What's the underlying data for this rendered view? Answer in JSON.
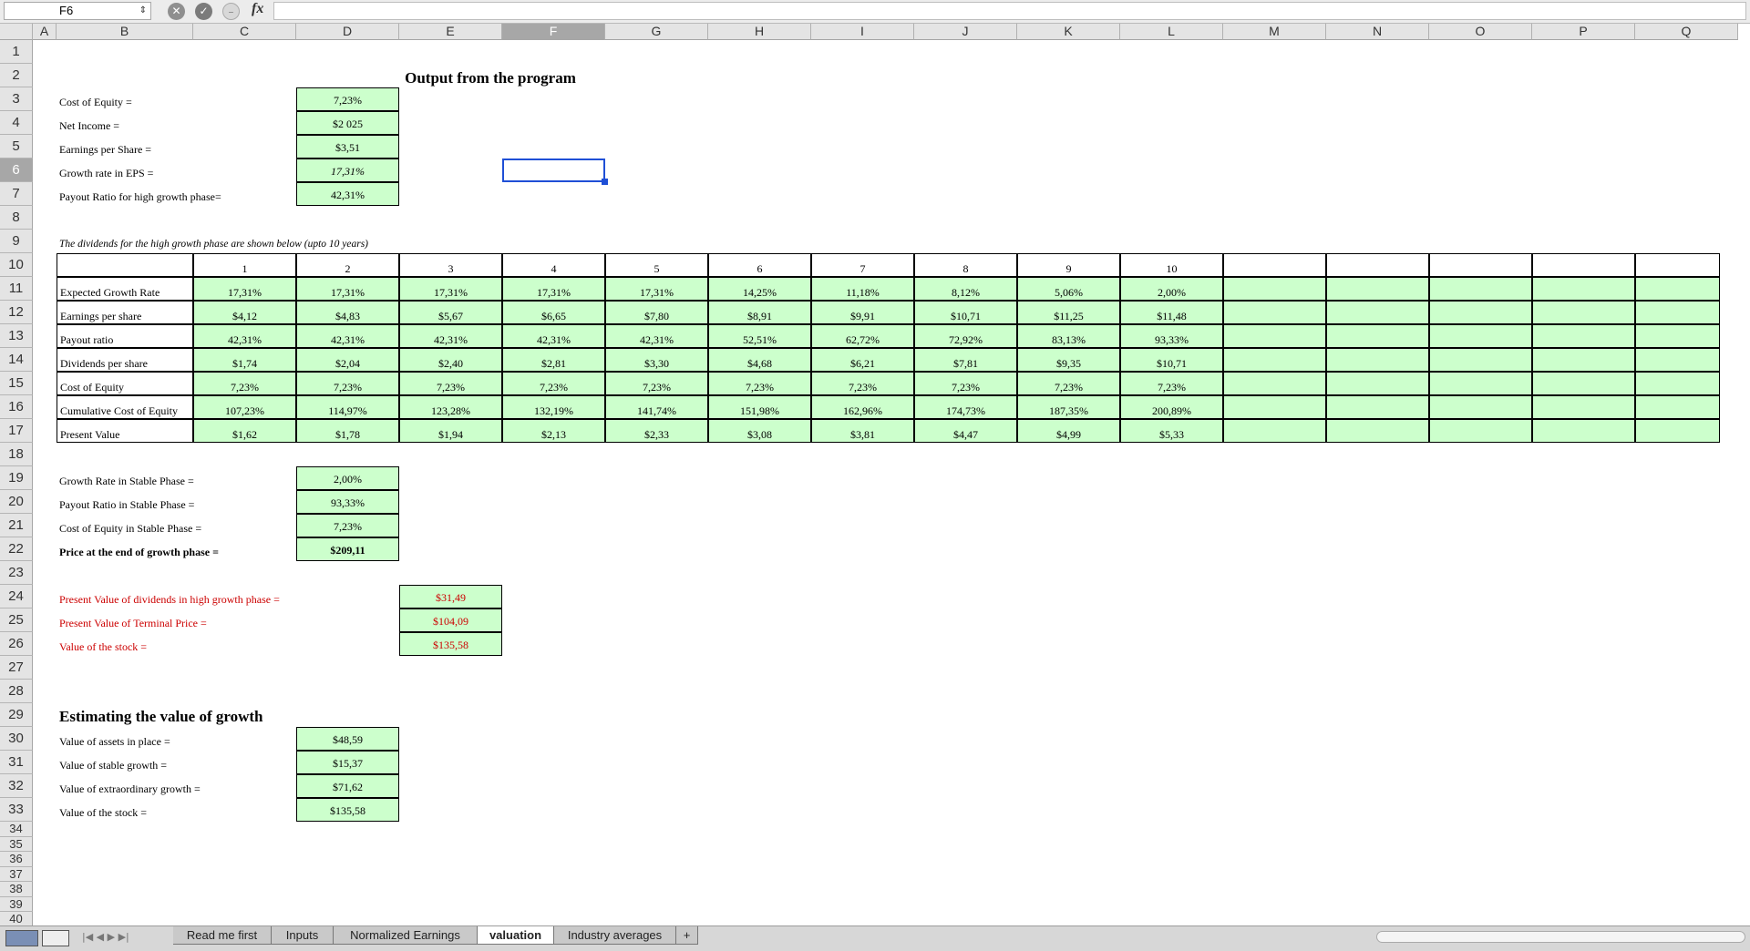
{
  "formula_bar": {
    "name_box": "F6",
    "formula": ""
  },
  "icons": {
    "nb": "up-down-arrows",
    "cancel": "x-circle-icon",
    "confirm": "check-circle-icon",
    "fx": "fx-icon"
  },
  "columns": [
    "A",
    "B",
    "C",
    "D",
    "E",
    "F",
    "G",
    "H",
    "I",
    "J",
    "K",
    "L",
    "M",
    "N",
    "O",
    "P",
    "Q"
  ],
  "rows": [
    "1",
    "2",
    "3",
    "4",
    "5",
    "6",
    "7",
    "8",
    "9",
    "10",
    "11",
    "12",
    "13",
    "14",
    "15",
    "16",
    "17",
    "18",
    "19",
    "20",
    "21",
    "22",
    "23",
    "24",
    "25",
    "26",
    "27",
    "28",
    "29",
    "30",
    "31",
    "32",
    "33",
    "34",
    "35",
    "36",
    "37",
    "38",
    "39",
    "40"
  ],
  "selected_column": "F",
  "selected_row": "6",
  "title": "Output from the program",
  "inputs": [
    {
      "label": "Cost of Equity =",
      "value": "7,23%"
    },
    {
      "label": "Net Income =",
      "value": "$2 025"
    },
    {
      "label": "Earnings per Share =",
      "value": "$3,51"
    },
    {
      "label": "Growth rate in EPS =",
      "value": "17,31%"
    },
    {
      "label": "Payout Ratio for high growth phase=",
      "value": "42,31%"
    }
  ],
  "dividends_note": "The dividends for the high growth phase are shown below (upto 10 years)",
  "table": {
    "years": [
      "1",
      "2",
      "3",
      "4",
      "5",
      "6",
      "7",
      "8",
      "9",
      "10"
    ],
    "rows": [
      {
        "label": "Expected Growth Rate",
        "values": [
          "17,31%",
          "17,31%",
          "17,31%",
          "17,31%",
          "17,31%",
          "14,25%",
          "11,18%",
          "8,12%",
          "5,06%",
          "2,00%"
        ]
      },
      {
        "label": "Earnings per share",
        "values": [
          "$4,12",
          "$4,83",
          "$5,67",
          "$6,65",
          "$7,80",
          "$8,91",
          "$9,91",
          "$10,71",
          "$11,25",
          "$11,48"
        ]
      },
      {
        "label": "Payout ratio",
        "values": [
          "42,31%",
          "42,31%",
          "42,31%",
          "42,31%",
          "42,31%",
          "52,51%",
          "62,72%",
          "72,92%",
          "83,13%",
          "93,33%"
        ]
      },
      {
        "label": "Dividends per share",
        "values": [
          "$1,74",
          "$2,04",
          "$2,40",
          "$2,81",
          "$3,30",
          "$4,68",
          "$6,21",
          "$7,81",
          "$9,35",
          "$10,71"
        ]
      },
      {
        "label": "Cost of Equity",
        "values": [
          "7,23%",
          "7,23%",
          "7,23%",
          "7,23%",
          "7,23%",
          "7,23%",
          "7,23%",
          "7,23%",
          "7,23%",
          "7,23%"
        ]
      },
      {
        "label": "Cumulative Cost of Equity",
        "values": [
          "107,23%",
          "114,97%",
          "123,28%",
          "132,19%",
          "141,74%",
          "151,98%",
          "162,96%",
          "174,73%",
          "187,35%",
          "200,89%"
        ]
      },
      {
        "label": "Present Value",
        "values": [
          "$1,62",
          "$1,78",
          "$1,94",
          "$2,13",
          "$2,33",
          "$3,08",
          "$3,81",
          "$4,47",
          "$4,99",
          "$5,33"
        ]
      }
    ]
  },
  "stable": [
    {
      "label": "Growth Rate in Stable Phase =",
      "value": "2,00%"
    },
    {
      "label": "Payout Ratio in Stable Phase =",
      "value": "93,33%"
    },
    {
      "label": "Cost of Equity in Stable Phase =",
      "value": "7,23%"
    },
    {
      "label": "Price at the end of growth phase =",
      "value": "$209,11"
    }
  ],
  "valuation": [
    {
      "label": "Present Value of dividends in high growth phase =",
      "value": "$31,49"
    },
    {
      "label": "Present Value of Terminal Price =",
      "value": "$104,09"
    },
    {
      "label": "Value of the stock =",
      "value": "$135,58"
    }
  ],
  "growth_title": "Estimating the value of growth",
  "growth": [
    {
      "label": "Value of assets in place =",
      "value": "$48,59"
    },
    {
      "label": "Value of stable growth =",
      "value": "$15,37"
    },
    {
      "label": "Value of extraordinary growth =",
      "value": "$71,62"
    },
    {
      "label": "Value of the stock =",
      "value": "$135,58"
    }
  ],
  "sheet_tabs": [
    "Read me first",
    "Inputs",
    "Normalized Earnings",
    "valuation",
    "Industry averages",
    "+"
  ],
  "active_tab": "valuation",
  "nav_arrows": "|◀ ◀ ▶ ▶|"
}
